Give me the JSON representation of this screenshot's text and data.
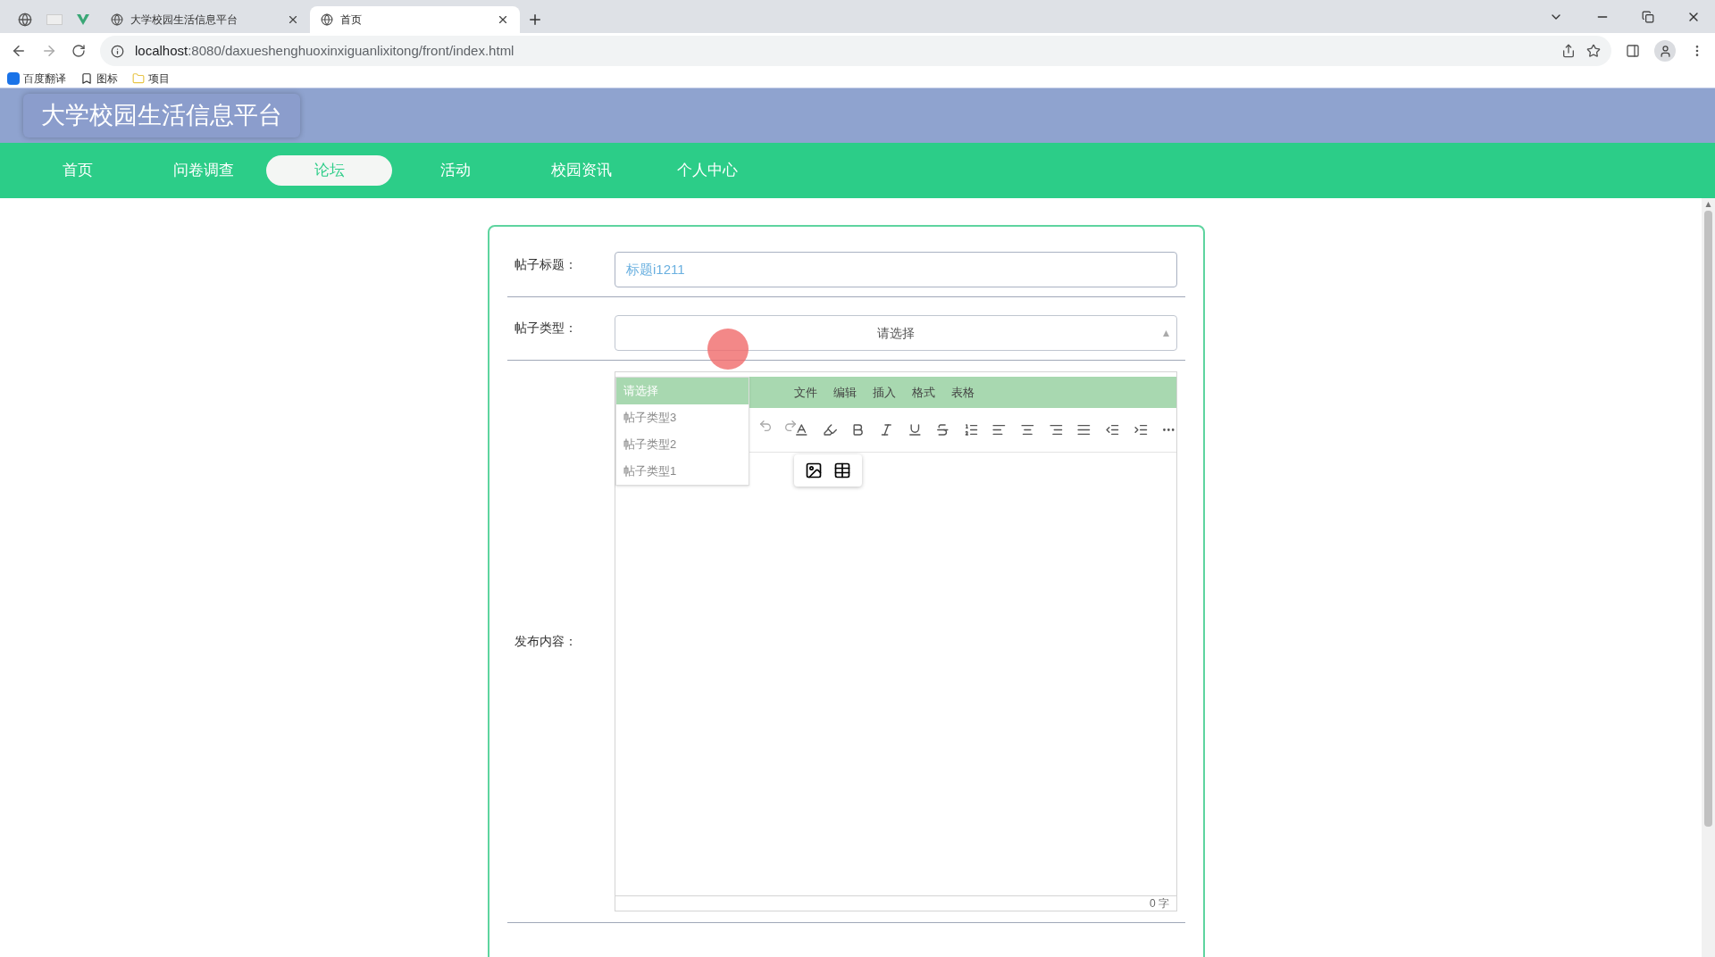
{
  "browser": {
    "tabs": [
      {
        "title": "大学校园生活信息平台",
        "selected": false
      },
      {
        "title": "首页",
        "selected": true
      }
    ],
    "address": {
      "host": "localhost",
      "path": ":8080/daxueshenghuoxinxiguanlixitong/front/index.html"
    },
    "bookmarks": [
      "百度翻译",
      "图标",
      "项目"
    ]
  },
  "site_title": "大学校园生活信息平台",
  "nav": [
    {
      "label": "首页",
      "selected": false
    },
    {
      "label": "问卷调查",
      "selected": false
    },
    {
      "label": "论坛",
      "selected": true
    },
    {
      "label": "活动",
      "selected": false
    },
    {
      "label": "校园资讯",
      "selected": false
    },
    {
      "label": "个人中心",
      "selected": false
    }
  ],
  "form": {
    "title_label": "帖子标题：",
    "title_value": "标题i1211",
    "type_label": "帖子类型：",
    "type_placeholder": "请选择",
    "type_options": [
      {
        "label": "请选择",
        "selected": true
      },
      {
        "label": "帖子类型3",
        "selected": false
      },
      {
        "label": "帖子类型2",
        "selected": false
      },
      {
        "label": "帖子类型1",
        "selected": false
      }
    ],
    "content_label": "发布内容：",
    "editor_menu": [
      "文件",
      "编辑",
      "插入",
      "格式",
      "表格"
    ],
    "word_count": "0 字"
  }
}
